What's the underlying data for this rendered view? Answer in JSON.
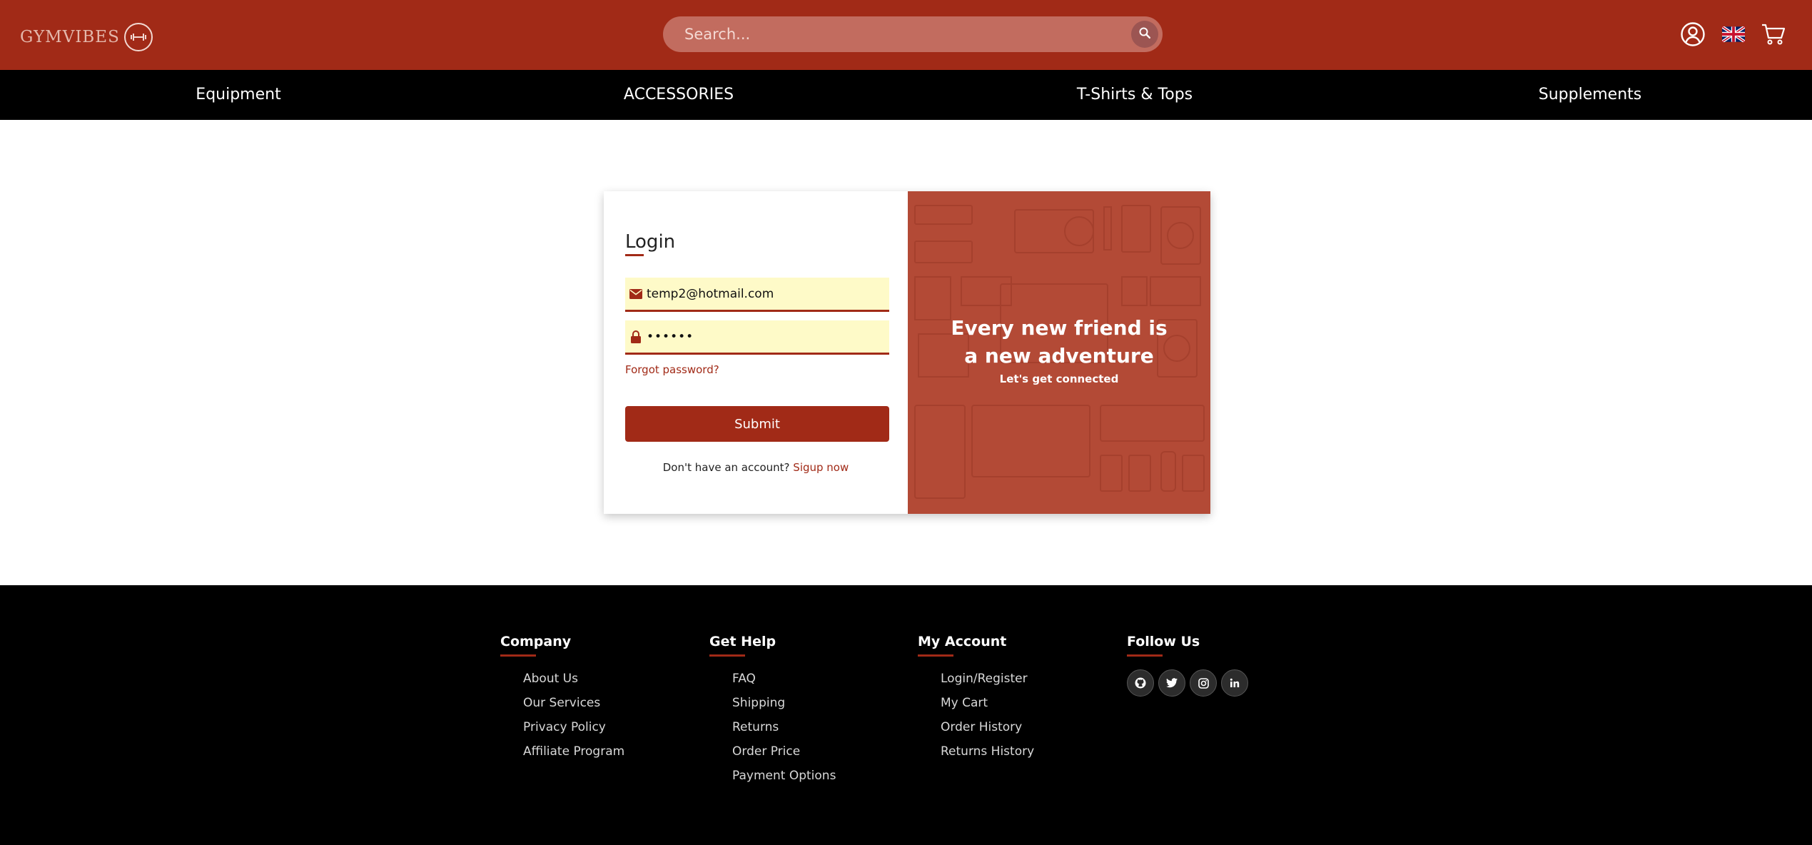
{
  "header": {
    "logo_text": "GYMVIBES",
    "search_placeholder": "Search...",
    "icons": [
      "user-account-icon",
      "uk-flag-icon",
      "cart-icon",
      "search-icon"
    ]
  },
  "nav": {
    "items": [
      {
        "label": "Equipment"
      },
      {
        "label": "ACCESSORIES"
      },
      {
        "label": "T-Shirts & Tops"
      },
      {
        "label": "Supplements"
      }
    ]
  },
  "login": {
    "title": "Login",
    "email_value": "temp2@hotmail.com",
    "password_value": "••••••",
    "forgot_label": "Forgot password?",
    "submit_label": "Submit",
    "no_account_text": "Don't have an account?",
    "signup_label": "Sigup now"
  },
  "hero": {
    "title": "Every new friend is a new adventure",
    "subtitle": "Let's get connected"
  },
  "footer": {
    "company": {
      "title": "Company",
      "links": [
        "About Us",
        "Our Services",
        "Privacy Policy",
        "Affiliate Program"
      ]
    },
    "help": {
      "title": "Get Help",
      "links": [
        "FAQ",
        "Shipping",
        "Returns",
        "Order Price",
        "Payment Options"
      ]
    },
    "account": {
      "title": "My Account",
      "links": [
        "Login/Register",
        "My Cart",
        "Order History",
        "Returns History"
      ]
    },
    "follow": {
      "title": "Follow Us",
      "socials": [
        "github-icon",
        "twitter-icon",
        "instagram-icon",
        "linkedin-icon"
      ]
    }
  },
  "colors": {
    "brand": "#a12a17",
    "hero_bg": "#b34a36",
    "field_bg": "#fefac8",
    "nav_bg": "#000000"
  }
}
